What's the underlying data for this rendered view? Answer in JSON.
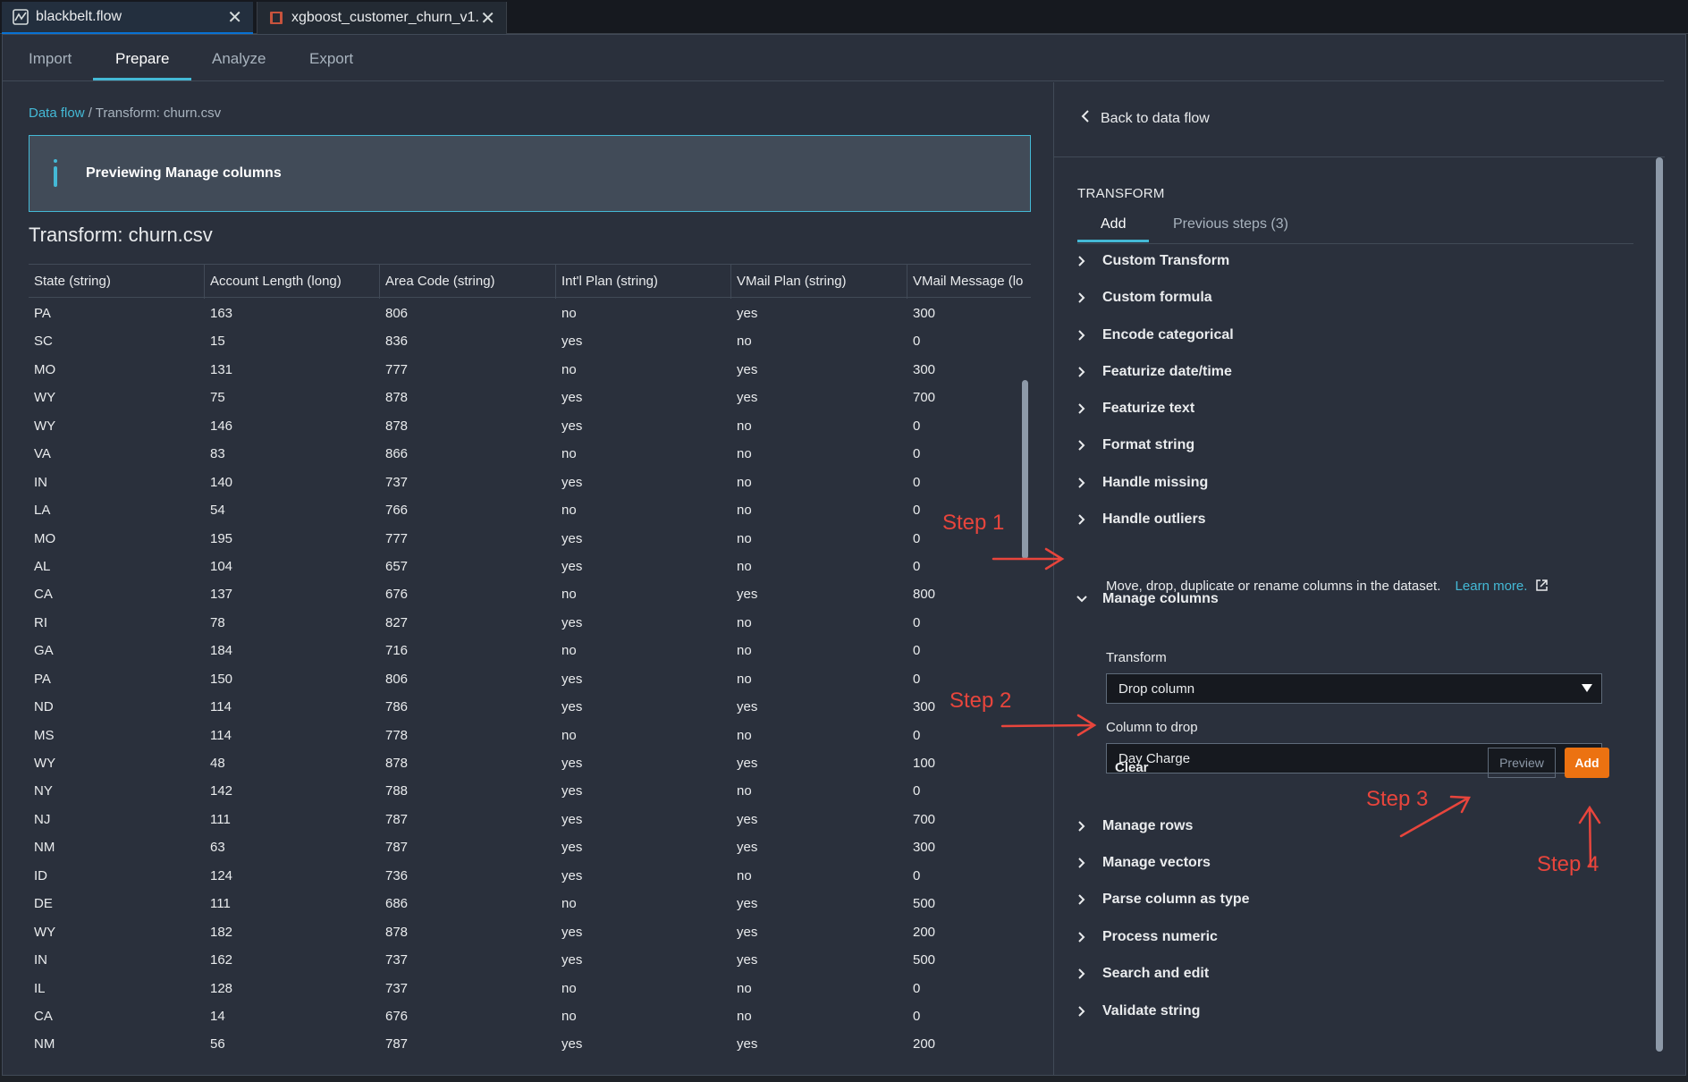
{
  "file_tabs": [
    {
      "label": "blackbelt.flow",
      "active": true
    },
    {
      "label": "xgboost_customer_churn_v1.",
      "active": false
    }
  ],
  "page_tabs": [
    "Import",
    "Prepare",
    "Analyze",
    "Export"
  ],
  "active_page_tab": "Prepare",
  "breadcrumb": {
    "link": "Data flow",
    "separator": "/",
    "current": "Transform: churn.csv"
  },
  "info_banner": "Previewing Manage columns",
  "dataset_title": "Transform: churn.csv",
  "table": {
    "columns": [
      "State (string)",
      "Account Length (long)",
      "Area Code (string)",
      "Int'l Plan (string)",
      "VMail Plan (string)",
      "VMail Message (lo"
    ],
    "rows": [
      [
        "PA",
        "163",
        "806",
        "no",
        "yes",
        "300"
      ],
      [
        "SC",
        "15",
        "836",
        "yes",
        "no",
        "0"
      ],
      [
        "MO",
        "131",
        "777",
        "no",
        "yes",
        "300"
      ],
      [
        "WY",
        "75",
        "878",
        "yes",
        "yes",
        "700"
      ],
      [
        "WY",
        "146",
        "878",
        "yes",
        "no",
        "0"
      ],
      [
        "VA",
        "83",
        "866",
        "no",
        "no",
        "0"
      ],
      [
        "IN",
        "140",
        "737",
        "yes",
        "no",
        "0"
      ],
      [
        "LA",
        "54",
        "766",
        "no",
        "no",
        "0"
      ],
      [
        "MO",
        "195",
        "777",
        "yes",
        "no",
        "0"
      ],
      [
        "AL",
        "104",
        "657",
        "yes",
        "no",
        "0"
      ],
      [
        "CA",
        "137",
        "676",
        "no",
        "yes",
        "800"
      ],
      [
        "RI",
        "78",
        "827",
        "yes",
        "no",
        "0"
      ],
      [
        "GA",
        "184",
        "716",
        "no",
        "no",
        "0"
      ],
      [
        "PA",
        "150",
        "806",
        "yes",
        "no",
        "0"
      ],
      [
        "ND",
        "114",
        "786",
        "yes",
        "yes",
        "300"
      ],
      [
        "MS",
        "114",
        "778",
        "no",
        "no",
        "0"
      ],
      [
        "WY",
        "48",
        "878",
        "yes",
        "yes",
        "100"
      ],
      [
        "NY",
        "142",
        "788",
        "yes",
        "no",
        "0"
      ],
      [
        "NJ",
        "111",
        "787",
        "yes",
        "yes",
        "700"
      ],
      [
        "NM",
        "63",
        "787",
        "yes",
        "yes",
        "300"
      ],
      [
        "ID",
        "124",
        "736",
        "yes",
        "no",
        "0"
      ],
      [
        "DE",
        "111",
        "686",
        "no",
        "yes",
        "500"
      ],
      [
        "WY",
        "182",
        "878",
        "yes",
        "yes",
        "200"
      ],
      [
        "IN",
        "162",
        "737",
        "yes",
        "yes",
        "500"
      ],
      [
        "IL",
        "128",
        "737",
        "no",
        "no",
        "0"
      ],
      [
        "CA",
        "14",
        "676",
        "no",
        "no",
        "0"
      ],
      [
        "NM",
        "56",
        "787",
        "yes",
        "yes",
        "200"
      ]
    ]
  },
  "side_panel": {
    "back_label": "Back to data flow",
    "section_title": "TRANSFORM",
    "tabs": [
      "Add",
      "Previous steps (3)"
    ],
    "transforms_before": [
      "Custom Transform",
      "Custom formula",
      "Encode categorical",
      "Featurize date/time",
      "Featurize text",
      "Format string",
      "Handle missing",
      "Handle outliers"
    ],
    "expanded": {
      "title": "Manage columns",
      "description": "Move, drop, duplicate or rename columns in the dataset.",
      "learn_more": "Learn more.",
      "transform_label": "Transform",
      "transform_value": "Drop column",
      "column_label": "Column to drop",
      "column_value": "Day Charge",
      "clear_label": "Clear",
      "preview_label": "Preview",
      "add_label": "Add"
    },
    "transforms_after": [
      "Manage rows",
      "Manage vectors",
      "Parse column as type",
      "Process numeric",
      "Search and edit",
      "Validate string"
    ]
  },
  "annotations": [
    "Step 1",
    "Step 2",
    "Step 3",
    "Step 4"
  ],
  "colors": {
    "accent": "#44b9d6",
    "add_button": "#ec7211",
    "annotation": "#e8453c"
  }
}
